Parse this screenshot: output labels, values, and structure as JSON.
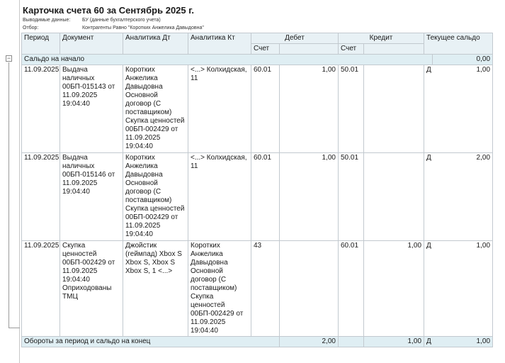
{
  "report": {
    "title": "Карточка счета 60 за Сентябрь 2025 г.",
    "meta": [
      {
        "key": "Выводимые данные:",
        "value": "БУ (данные бухгалтерского учета)"
      },
      {
        "key": "Отбор:",
        "value": "Контрагенты Равно \"Коротких Анжелика Давыдовна\""
      }
    ]
  },
  "table": {
    "headers": {
      "period": "Период",
      "document": "Документ",
      "analytics_dt": "Аналитика Дт",
      "analytics_kt": "Аналитика Кт",
      "debit": "Дебет",
      "credit": "Кредит",
      "balance": "Текущее сальдо",
      "account": "Счет"
    },
    "opening": {
      "label": "Сальдо на начало",
      "value": "0,00"
    },
    "rows": [
      {
        "period": "11.09.2025",
        "document": "Выдача наличных 00БП-015143 от 11.09.2025 19:04:40",
        "analytics_dt": "Коротких Анжелика Давыдовна Основной договор (С поставщиком) Скупка ценностей 00БП-002429 от 11.09.2025 19:04:40",
        "analytics_kt": "<...> Колхидская, 11",
        "dt_account": "60.01",
        "dt_amount": "1,00",
        "kt_account": "50.01",
        "kt_amount": "",
        "bal_side": "Д",
        "bal_amount": "1,00"
      },
      {
        "period": "11.09.2025",
        "document": "Выдача наличных 00БП-015146 от 11.09.2025 19:04:40",
        "analytics_dt": "Коротких Анжелика Давыдовна Основной договор (С поставщиком) Скупка ценностей 00БП-002429 от 11.09.2025 19:04:40",
        "analytics_kt": "<...> Колхидская, 11",
        "dt_account": "60.01",
        "dt_amount": "1,00",
        "kt_account": "50.01",
        "kt_amount": "",
        "bal_side": "Д",
        "bal_amount": "2,00"
      },
      {
        "period": "11.09.2025",
        "document": "Скупка ценностей 00БП-002429 от 11.09.2025 19:04:40 Оприходованы ТМЦ",
        "analytics_dt": "Джойстик (геймпад) Xbox S Xbox S, Xbox S Xbox S, 1 <...>",
        "analytics_kt": "Коротких Анжелика Давыдовна Основной договор (С поставщиком) Скупка ценностей 00БП-002429 от 11.09.2025 19:04:40",
        "dt_account": "43",
        "dt_amount": "",
        "kt_account": "60.01",
        "kt_amount": "1,00",
        "bal_side": "Д",
        "bal_amount": "1,00"
      }
    ],
    "totals": {
      "label": "Обороты за период и сальдо на конец",
      "debit": "2,00",
      "credit": "1,00",
      "bal_side": "Д",
      "bal_amount": "1,00"
    }
  }
}
